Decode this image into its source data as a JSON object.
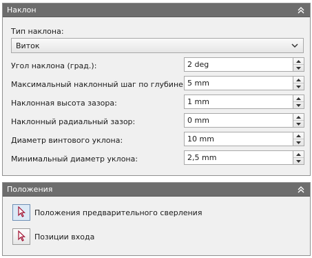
{
  "panel1": {
    "title": "Наклон",
    "type_label": "Тип наклона:",
    "type_value": "Виток",
    "rows": [
      {
        "label": "Угол наклона (град.):",
        "value": "2 deg"
      },
      {
        "label": "Максимальный наклонный шаг по глубине:",
        "value": "5 mm"
      },
      {
        "label": "Наклонная высота зазора:",
        "value": "1 mm"
      },
      {
        "label": "Наклонный радиальный зазор:",
        "value": "0 mm"
      },
      {
        "label": "Диаметр винтового уклона:",
        "value": "10 mm"
      },
      {
        "label": "Минимальный диаметр уклона:",
        "value": "2,5 mm"
      }
    ]
  },
  "panel2": {
    "title": "Положения",
    "items": [
      {
        "label": "Положения предварительного сверления",
        "icon": "cursor-arrow-icon",
        "active": true
      },
      {
        "label": "Позиции входа",
        "icon": "cursor-arrow-icon",
        "active": false
      }
    ]
  },
  "colors": {
    "header": "#6d6d6d",
    "panel_bg": "#f0f0f0",
    "cursor": "#a01030"
  }
}
